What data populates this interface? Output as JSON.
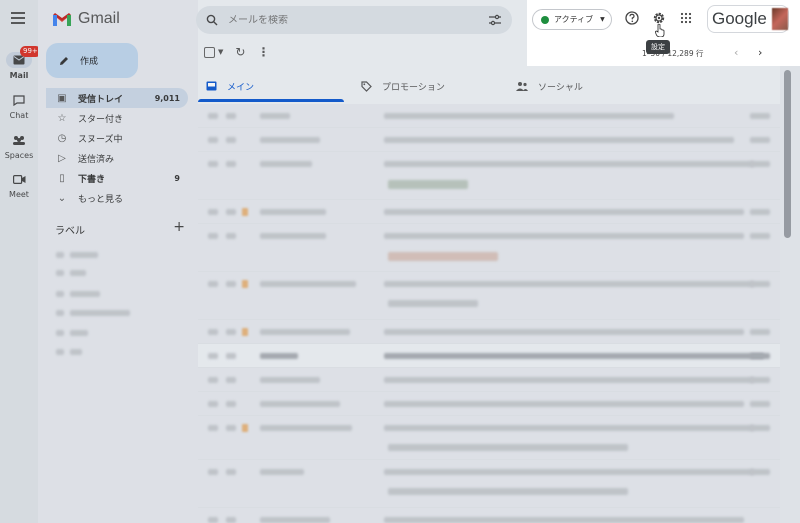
{
  "rail": {
    "items": [
      {
        "label": "Mail",
        "icon": "mail-icon",
        "badge": "99+"
      },
      {
        "label": "Chat",
        "icon": "chat-icon"
      },
      {
        "label": "Spaces",
        "icon": "spaces-icon"
      },
      {
        "label": "Meet",
        "icon": "meet-icon"
      }
    ]
  },
  "app": {
    "name": "Gmail",
    "brand_color": "#ea4335"
  },
  "compose_label": "作成",
  "nav": [
    {
      "label": "受信トレイ",
      "count": "9,011",
      "icon": "inbox-icon",
      "active": true
    },
    {
      "label": "スター付き",
      "count": "",
      "icon": "star-icon"
    },
    {
      "label": "スヌーズ中",
      "count": "",
      "icon": "clock-icon"
    },
    {
      "label": "送信済み",
      "count": "",
      "icon": "send-icon"
    },
    {
      "label": "下書き",
      "count": "9",
      "icon": "draft-icon"
    },
    {
      "label": "もっと見る",
      "count": "",
      "icon": "chevron-down-icon"
    }
  ],
  "labels_heading": "ラベル",
  "search": {
    "placeholder": "メールを検索"
  },
  "tabs": [
    {
      "label": "メイン",
      "icon": "inbox-icon"
    },
    {
      "label": "プロモーション",
      "icon": "tag-icon"
    },
    {
      "label": "ソーシャル",
      "icon": "people-icon"
    }
  ],
  "header": {
    "status": "アクティブ",
    "status_color": "#1e8e3e",
    "google_label": "Google",
    "tooltip": "設定",
    "pagination": "1–50 / 12,289 行"
  },
  "accent": "#0b57d0"
}
